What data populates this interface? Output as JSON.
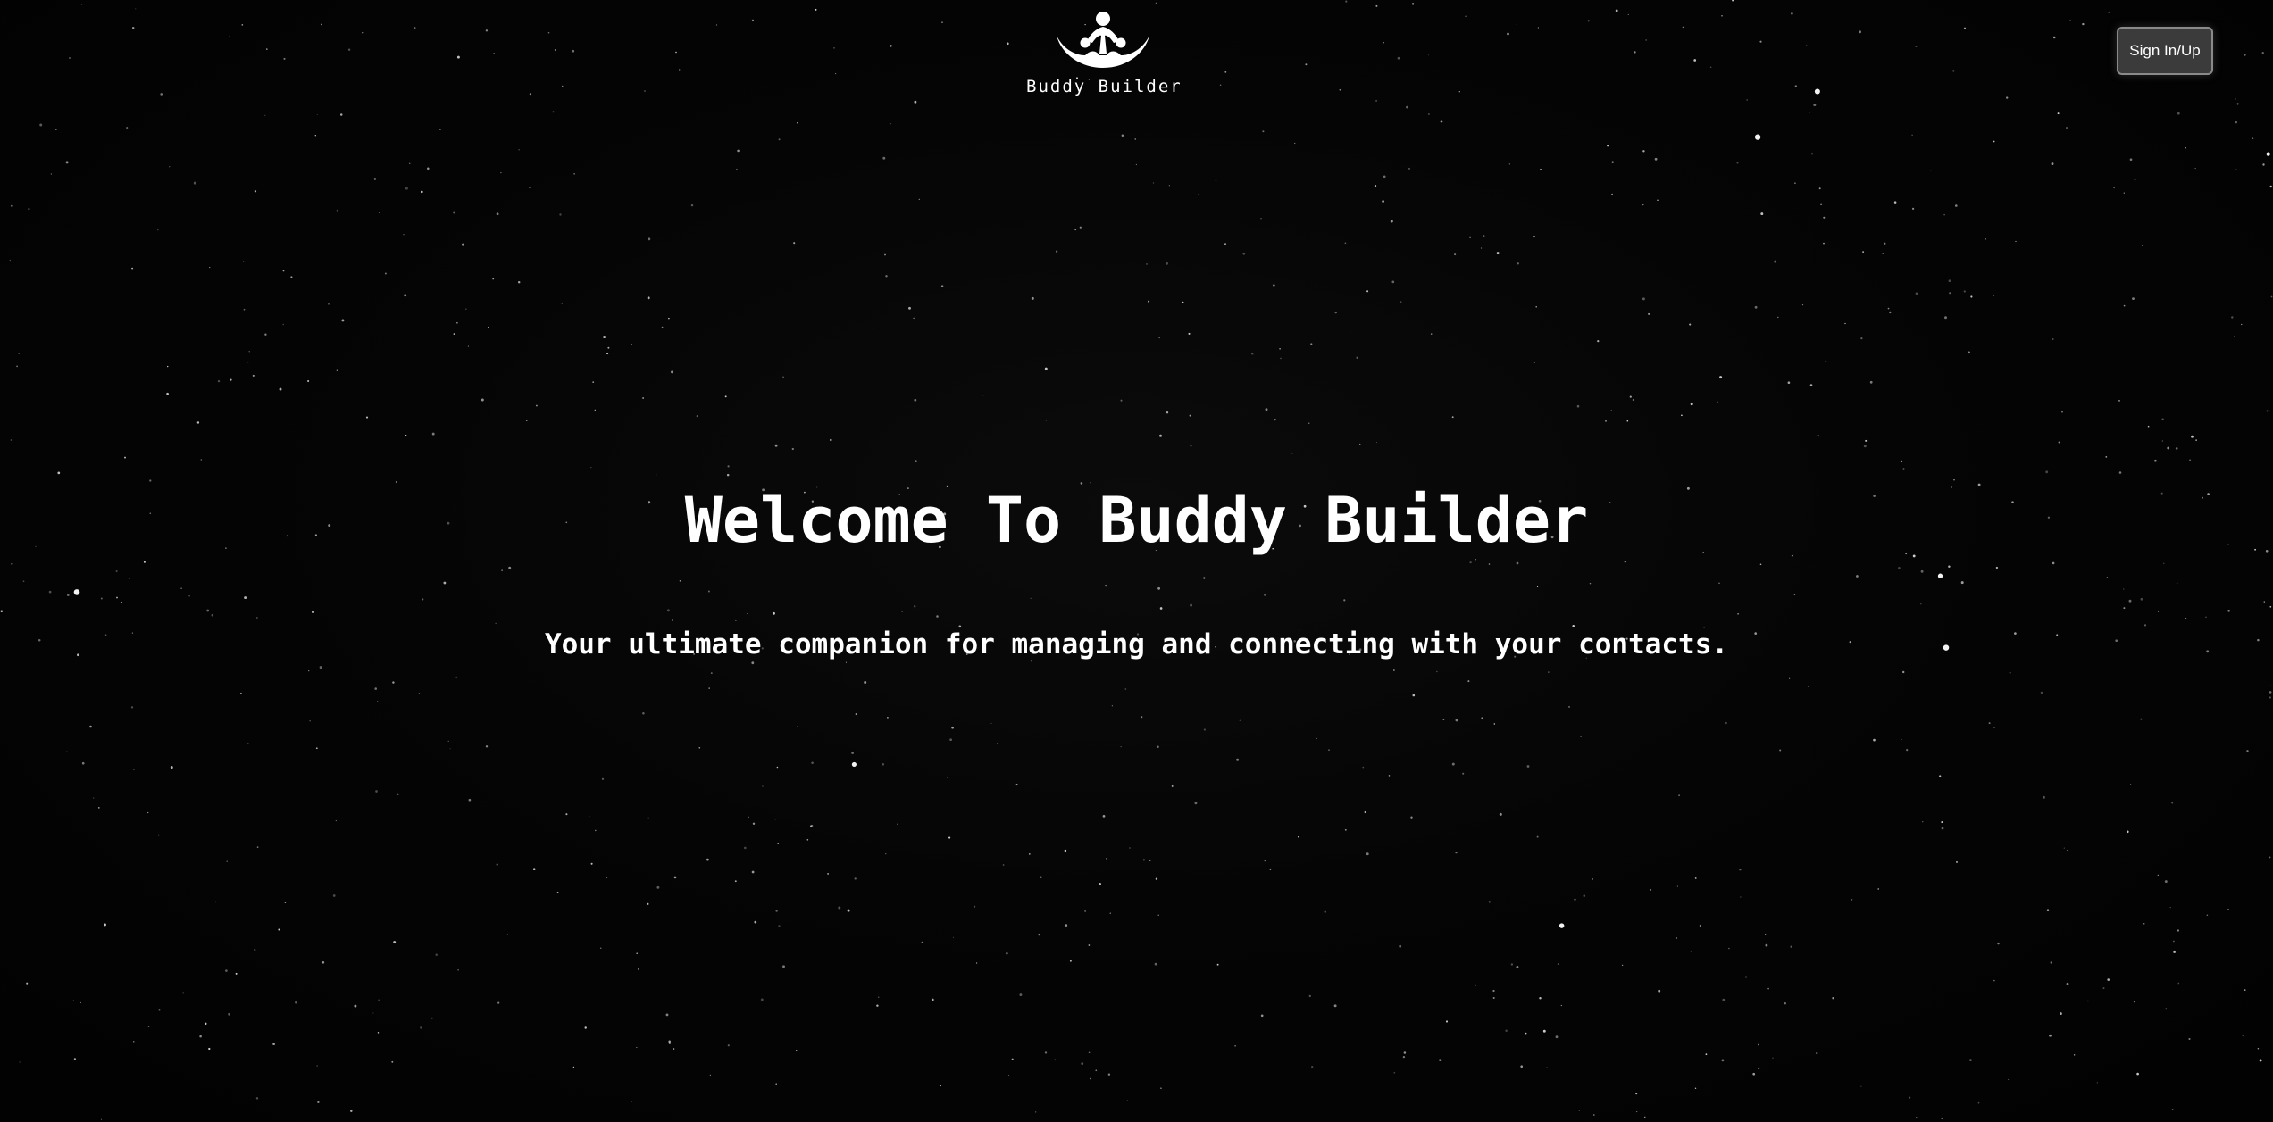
{
  "header": {
    "logo_text": "Buddy Builder",
    "signin_label": "Sign In/Up"
  },
  "hero": {
    "title": "Welcome To Buddy Builder",
    "subtitle": "Your ultimate companion for managing and connecting with your contacts."
  },
  "theme": {
    "background": "#030303",
    "text": "#ffffff",
    "button_bg": "#3b3b3b",
    "button_border": "#8a8a8a"
  }
}
